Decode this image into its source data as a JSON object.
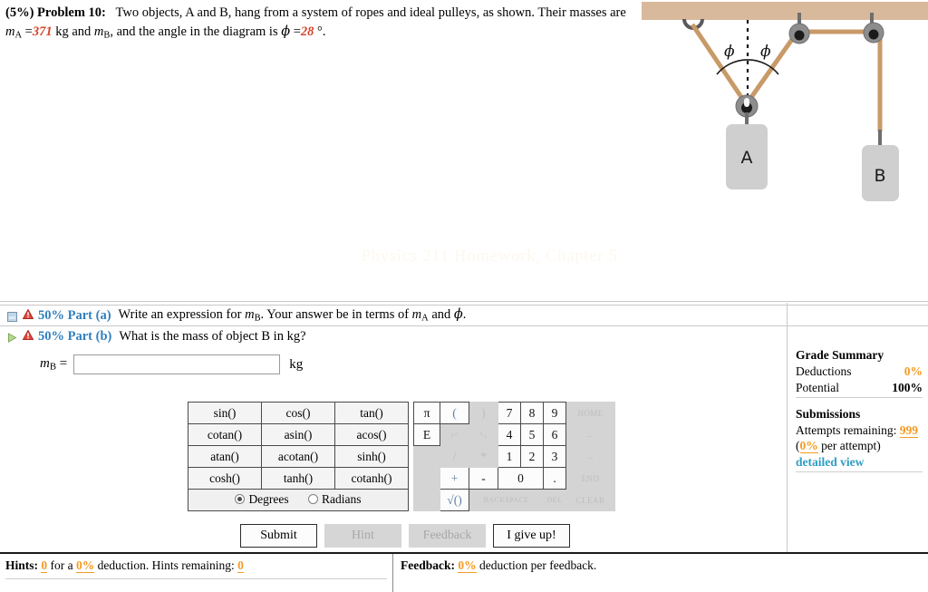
{
  "problem": {
    "percent": "(5%)",
    "title": "Problem 10:",
    "text_1": "Two objects, A and B, hang from a system of ropes and ideal pulleys, as shown. Their masses are",
    "m_a_symbol": "m",
    "m_a_sub": "A",
    "equals": "=",
    "m_a_value": "371",
    "unit_kg": "kg",
    "text_2": "and",
    "m_b_symbol": "m",
    "m_b_sub": "B",
    "text_3": ", and the angle in the diagram is",
    "phi_symbol": "ϕ",
    "phi_value": "28",
    "degree": "°",
    "period": "."
  },
  "diagram": {
    "label_a": "A",
    "label_b": "B",
    "angle_label_left": "ϕ",
    "angle_label_right": "ϕ",
    "ceiling_color": "#d8b99c",
    "rope_color": "#c89a68",
    "pulley_color": "#8d8d8d",
    "block_color": "#cfcfcf"
  },
  "watermark": {
    "text": "Physics 211 Homework, Chapter 5"
  },
  "parts": [
    {
      "id": "a",
      "weight": "50%",
      "name": "Part (a)",
      "toggle_icon": "minimize-icon",
      "status_icon": "warning-icon",
      "question_pre": "Write an expression for",
      "var_symbol": "m",
      "var_sub": "B",
      "question_mid": ". Your answer be in terms of",
      "var2_symbol": "m",
      "var2_sub": "A",
      "question_and": "and",
      "var3_symbol": "ϕ",
      "question_end": "."
    },
    {
      "id": "b",
      "weight": "50%",
      "name": "Part (b)",
      "toggle_icon": "expand-arrow-icon",
      "status_icon": "warning-icon",
      "question_pre": "What is the mass of object B in kg?",
      "var_symbol": "",
      "var_sub": "",
      "question_mid": "",
      "var2_symbol": "",
      "var2_sub": "",
      "question_and": "",
      "var3_symbol": "",
      "question_end": ""
    }
  ],
  "answer": {
    "label_symbol": "m",
    "label_sub": "B",
    "label_eq": "=",
    "value": "",
    "placeholder": "",
    "unit": "kg"
  },
  "keypad": {
    "functions": [
      [
        "sin()",
        "cos()",
        "tan()"
      ],
      [
        "cotan()",
        "asin()",
        "acos()"
      ],
      [
        "atan()",
        "acotan()",
        "sinh()"
      ],
      [
        "cosh()",
        "tanh()",
        "cotanh()"
      ]
    ],
    "angle_mode": {
      "degrees_label": "Degrees",
      "radians_label": "Radians",
      "selected": "Degrees"
    },
    "numpad": [
      [
        {
          "t": "π",
          "s": "live"
        },
        {
          "t": "(",
          "s": "op"
        },
        {
          "t": ")",
          "s": "dim"
        },
        {
          "t": "7",
          "s": "live"
        },
        {
          "t": "8",
          "s": "live"
        },
        {
          "t": "9",
          "s": "live"
        },
        {
          "t": "HOME",
          "s": "dim-tiny"
        }
      ],
      [
        {
          "t": "E",
          "s": "live"
        },
        {
          "t": "↑^",
          "s": "dim"
        },
        {
          "t": "^↓",
          "s": "dim"
        },
        {
          "t": "4",
          "s": "live"
        },
        {
          "t": "5",
          "s": "live"
        },
        {
          "t": "6",
          "s": "live"
        },
        {
          "t": "←",
          "s": "dim-tiny"
        }
      ],
      [
        {
          "t": "",
          "s": "dim"
        },
        {
          "t": "/",
          "s": "dim"
        },
        {
          "t": "*",
          "s": "dim"
        },
        {
          "t": "1",
          "s": "live"
        },
        {
          "t": "2",
          "s": "live"
        },
        {
          "t": "3",
          "s": "live"
        },
        {
          "t": "→",
          "s": "dim-tiny"
        }
      ],
      [
        {
          "t": "",
          "s": "dim"
        },
        {
          "t": "+",
          "s": "op"
        },
        {
          "t": "-",
          "s": "live"
        },
        {
          "t": "0",
          "s": "live-wide"
        },
        {
          "t": ".",
          "s": "live"
        },
        {
          "t": "END",
          "s": "dim-tiny"
        }
      ],
      [
        {
          "t": "",
          "s": "dim"
        },
        {
          "t": "√()",
          "s": "op"
        },
        {
          "t": "BACKSPACE",
          "s": "dim-wide-tiny"
        },
        {
          "t": "DEL",
          "s": "dim-vtiny"
        },
        {
          "t": "CLEAR",
          "s": "dim-tiny"
        }
      ]
    ]
  },
  "buttons": [
    {
      "label": "Submit",
      "enabled": true
    },
    {
      "label": "Hint",
      "enabled": false
    },
    {
      "label": "Feedback",
      "enabled": false
    },
    {
      "label": "I give up!",
      "enabled": true
    }
  ],
  "grade_summary": {
    "title": "Grade Summary",
    "deductions_label": "Deductions",
    "deductions_value": "0%",
    "potential_label": "Potential",
    "potential_value": "100%",
    "submissions_title": "Submissions",
    "attempts_label": "Attempts remaining:",
    "attempts_value": "999",
    "per_attempt_value": "0%",
    "per_attempt_suffix": "per attempt)",
    "per_attempt_prefix": "(",
    "detailed_view": "detailed view"
  },
  "bottom": {
    "hints_label": "Hints:",
    "hints_count": "0",
    "hints_mid": "for a",
    "hints_deduction": "0%",
    "hints_deduction_text": "deduction. Hints remaining:",
    "hints_remaining": "0",
    "feedback_label": "Feedback:",
    "feedback_deduction": "0%",
    "feedback_text": "deduction per feedback."
  }
}
